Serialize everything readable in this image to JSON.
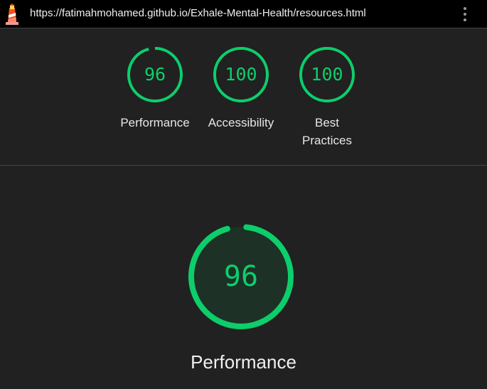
{
  "header": {
    "url": "https://fatimahmohamed.github.io/Exhale-Mental-Health/resources.html",
    "logo_icon": "lighthouse-icon",
    "menu_icon": "more-vert-icon"
  },
  "colors": {
    "pass": "#0cce6b",
    "pass_fill": "#1d3126",
    "background": "#212121",
    "topbar": "#000000"
  },
  "scores": [
    {
      "label": "Performance",
      "value": "96"
    },
    {
      "label": "Accessibility",
      "value": "100"
    },
    {
      "label": "Best Practices",
      "value": "100"
    }
  ],
  "main": {
    "label": "Performance",
    "value": "96"
  }
}
